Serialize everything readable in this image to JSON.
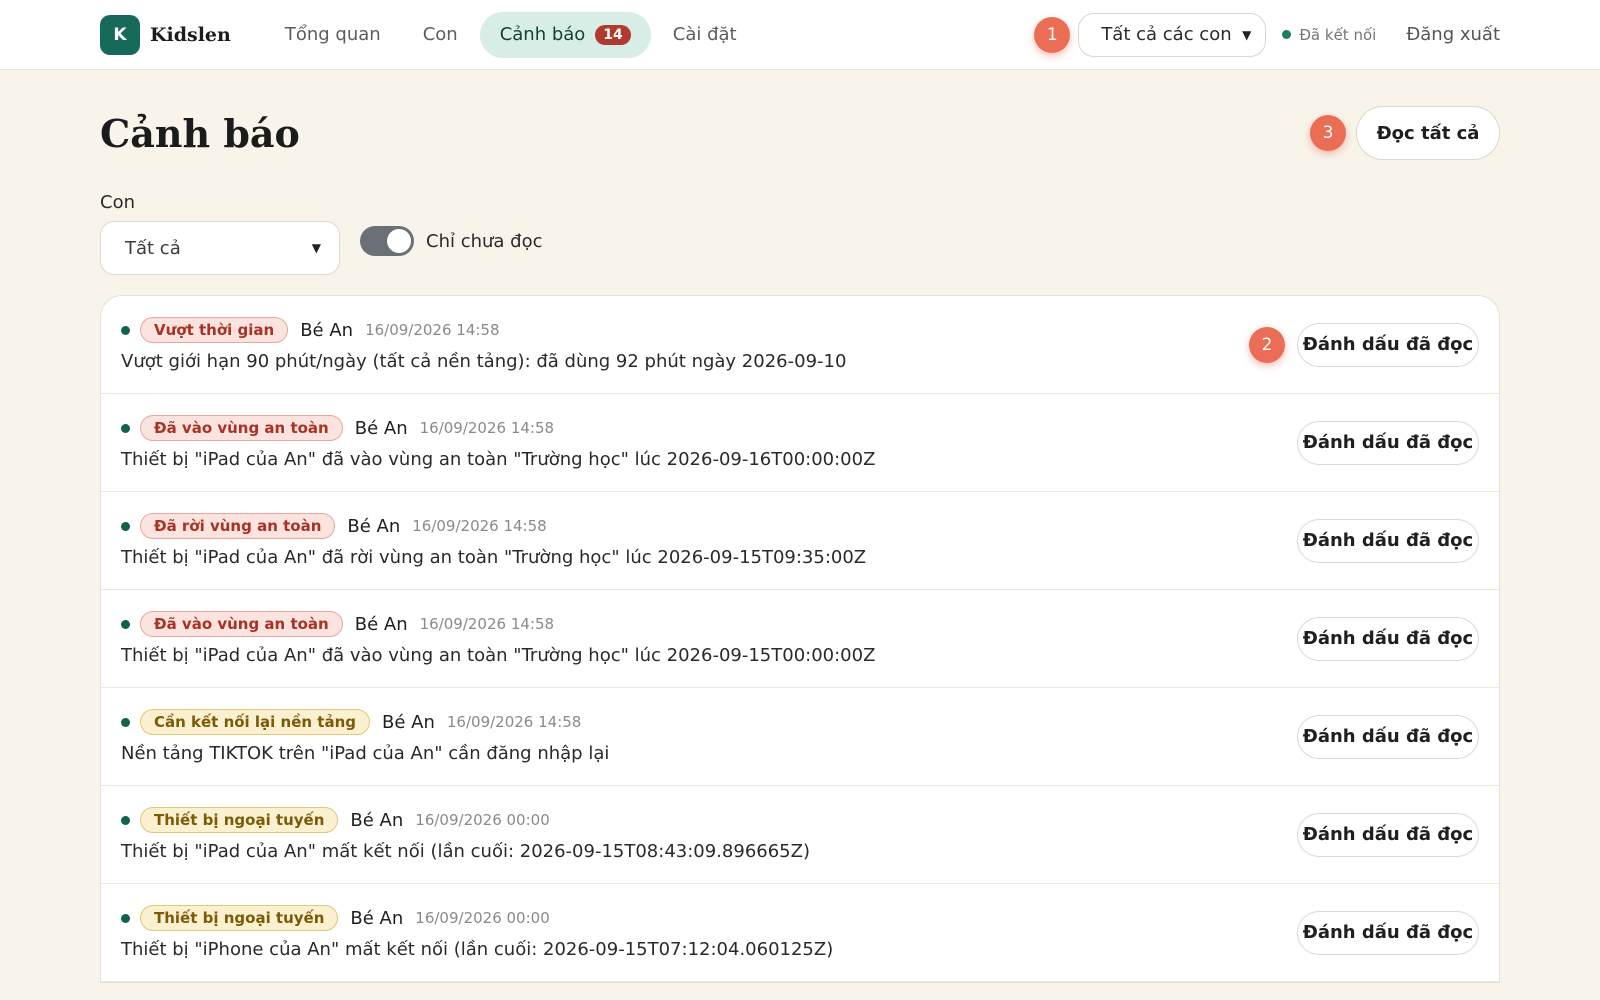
{
  "app": {
    "logo_letter": "K",
    "name": "Kidslen"
  },
  "nav": [
    {
      "label": "Tổng quan"
    },
    {
      "label": "Con"
    },
    {
      "label": "Cảnh báo",
      "badge": "14"
    },
    {
      "label": "Cài đặt"
    }
  ],
  "topbar": {
    "step": "1",
    "child_select_value": "Tất cả các con",
    "connection_status": "Đã kết nối",
    "logout_label": "Đăng xuất"
  },
  "page": {
    "title": "Cảnh báo",
    "read_all_step": "3",
    "read_all_label": "Đọc tất cả",
    "filter_label": "Con",
    "filter_value": "Tất cả",
    "toggle_label": "Chỉ chưa đọc",
    "toggle_on": true
  },
  "colors": {
    "accent": "#17695a",
    "badge": "#b03a2e",
    "step": "#ec6d56",
    "background": "#f8f4ea"
  },
  "alerts": [
    {
      "tag": "Vượt thời gian",
      "tag_color": "red",
      "child": "Bé An",
      "time": "16/09/2026 14:58",
      "message": "Vượt giới hạn 90 phút/ngày (tất cả nền tảng): đã dùng 92 phút ngày 2026-09-10",
      "step": "2",
      "action": "Đánh dấu đã đọc"
    },
    {
      "tag": "Đã vào vùng an toàn",
      "tag_color": "red",
      "child": "Bé An",
      "time": "16/09/2026 14:58",
      "message": "Thiết bị \"iPad của An\" đã vào vùng an toàn \"Trường học\" lúc 2026-09-16T00:00:00Z",
      "action": "Đánh dấu đã đọc"
    },
    {
      "tag": "Đã rời vùng an toàn",
      "tag_color": "red",
      "child": "Bé An",
      "time": "16/09/2026 14:58",
      "message": "Thiết bị \"iPad của An\" đã rời vùng an toàn \"Trường học\" lúc 2026-09-15T09:35:00Z",
      "action": "Đánh dấu đã đọc"
    },
    {
      "tag": "Đã vào vùng an toàn",
      "tag_color": "red",
      "child": "Bé An",
      "time": "16/09/2026 14:58",
      "message": "Thiết bị \"iPad của An\" đã vào vùng an toàn \"Trường học\" lúc 2026-09-15T00:00:00Z",
      "action": "Đánh dấu đã đọc"
    },
    {
      "tag": "Cần kết nối lại nền tảng",
      "tag_color": "yellow",
      "child": "Bé An",
      "time": "16/09/2026 14:58",
      "message": "Nền tảng TIKTOK trên \"iPad của An\" cần đăng nhập lại",
      "action": "Đánh dấu đã đọc"
    },
    {
      "tag": "Thiết bị ngoại tuyến",
      "tag_color": "yellow",
      "child": "Bé An",
      "time": "16/09/2026 00:00",
      "message": "Thiết bị \"iPad của An\" mất kết nối (lần cuối: 2026-09-15T08:43:09.896665Z)",
      "action": "Đánh dấu đã đọc"
    },
    {
      "tag": "Thiết bị ngoại tuyến",
      "tag_color": "yellow",
      "child": "Bé An",
      "time": "16/09/2026 00:00",
      "message": "Thiết bị \"iPhone của An\" mất kết nối (lần cuối: 2026-09-15T07:12:04.060125Z)",
      "action": "Đánh dấu đã đọc"
    }
  ]
}
